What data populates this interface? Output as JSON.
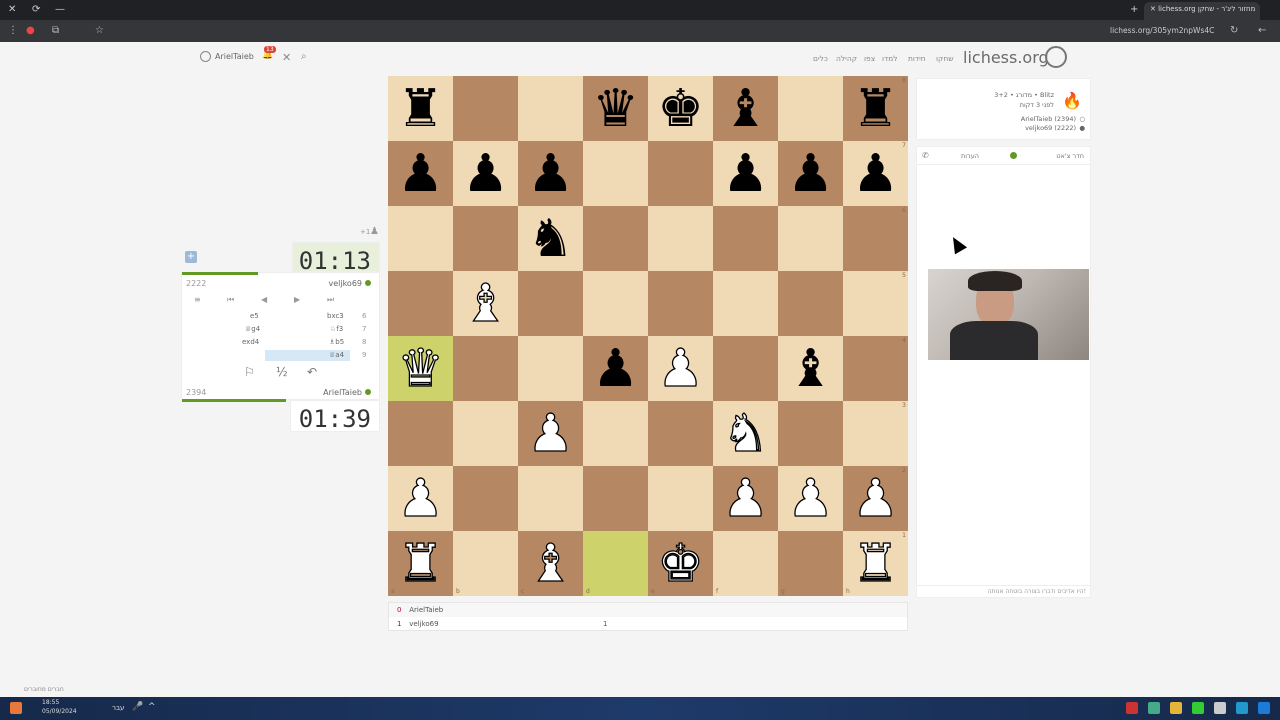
{
  "browser": {
    "tab_title": "lichess.org מחזור ליג'ר - שחקן",
    "url": "lichess.org/305ym2npWs4C"
  },
  "site": {
    "logo": "lichess.org",
    "nav": [
      "שחקו",
      "חידות",
      "למדו",
      "צפו",
      "קהילה",
      "כלים"
    ],
    "username": "ArielTaieb",
    "notifications": "13"
  },
  "game_info": {
    "line1": "3+2 • מדורג • Blitz",
    "line2": "לפני 3 דקות",
    "white": "ArielTaieb (2394)",
    "black": "veljko69 (2222)"
  },
  "chat": {
    "tab_room": "חדר צ'אט",
    "tab_notes": "הערות",
    "footer": "היו אדיבים ודברו בצורה בוטחה אנותה!"
  },
  "players": {
    "top": {
      "name": "veljko69",
      "rating": "2222",
      "clock": "01:13",
      "plus": "+1"
    },
    "bottom": {
      "name": "ArielTaieb",
      "rating": "2394",
      "clock": "01:39"
    }
  },
  "moves": [
    {
      "num": "6",
      "white": "e5",
      "black": "bxc3"
    },
    {
      "num": "7",
      "white": "♕g4",
      "black": "♘f3"
    },
    {
      "num": "8",
      "white": "exd4",
      "black": "♗b5"
    },
    {
      "num": "9",
      "white": "",
      "black": "♕a4"
    }
  ],
  "actions": {
    "flag": "⚐",
    "draw": "½",
    "takeback": "↶"
  },
  "controls": [
    "≡",
    "⏮",
    "◀",
    "▶",
    "⏭"
  ],
  "score": [
    {
      "idx": "0",
      "name": "ArielTaieb",
      "val": ""
    },
    {
      "idx": "1",
      "name": "veljko69",
      "val": "1"
    }
  ],
  "board": {
    "files": [
      "a",
      "b",
      "c",
      "d",
      "e",
      "f",
      "g",
      "h"
    ],
    "ranks": [
      "8",
      "7",
      "6",
      "5",
      "4",
      "3",
      "2",
      "1"
    ],
    "rows": [
      [
        "r",
        "",
        "",
        "q",
        "k",
        "b",
        "",
        "r"
      ],
      [
        "p",
        "p",
        "p",
        "",
        "",
        "p",
        "p",
        "p"
      ],
      [
        "",
        "",
        "n",
        "",
        "",
        "",
        "",
        ""
      ],
      [
        "",
        "B",
        "",
        "",
        "",
        "",
        "",
        ""
      ],
      [
        "Q",
        "",
        "",
        "p",
        "P",
        "",
        "b",
        ""
      ],
      [
        "",
        "",
        "P",
        "",
        "",
        "N",
        "",
        ""
      ],
      [
        "P",
        "",
        "",
        "",
        "",
        "P",
        "P",
        "P"
      ],
      [
        "R",
        "",
        "B",
        "",
        "K",
        "",
        "",
        "R"
      ]
    ],
    "highlight": [
      "a4",
      "d1"
    ]
  },
  "taskbar": {
    "time": "18:55",
    "date": "05/09/2024",
    "lang": "עבר"
  },
  "bottom_label": "חברים מחוברים"
}
